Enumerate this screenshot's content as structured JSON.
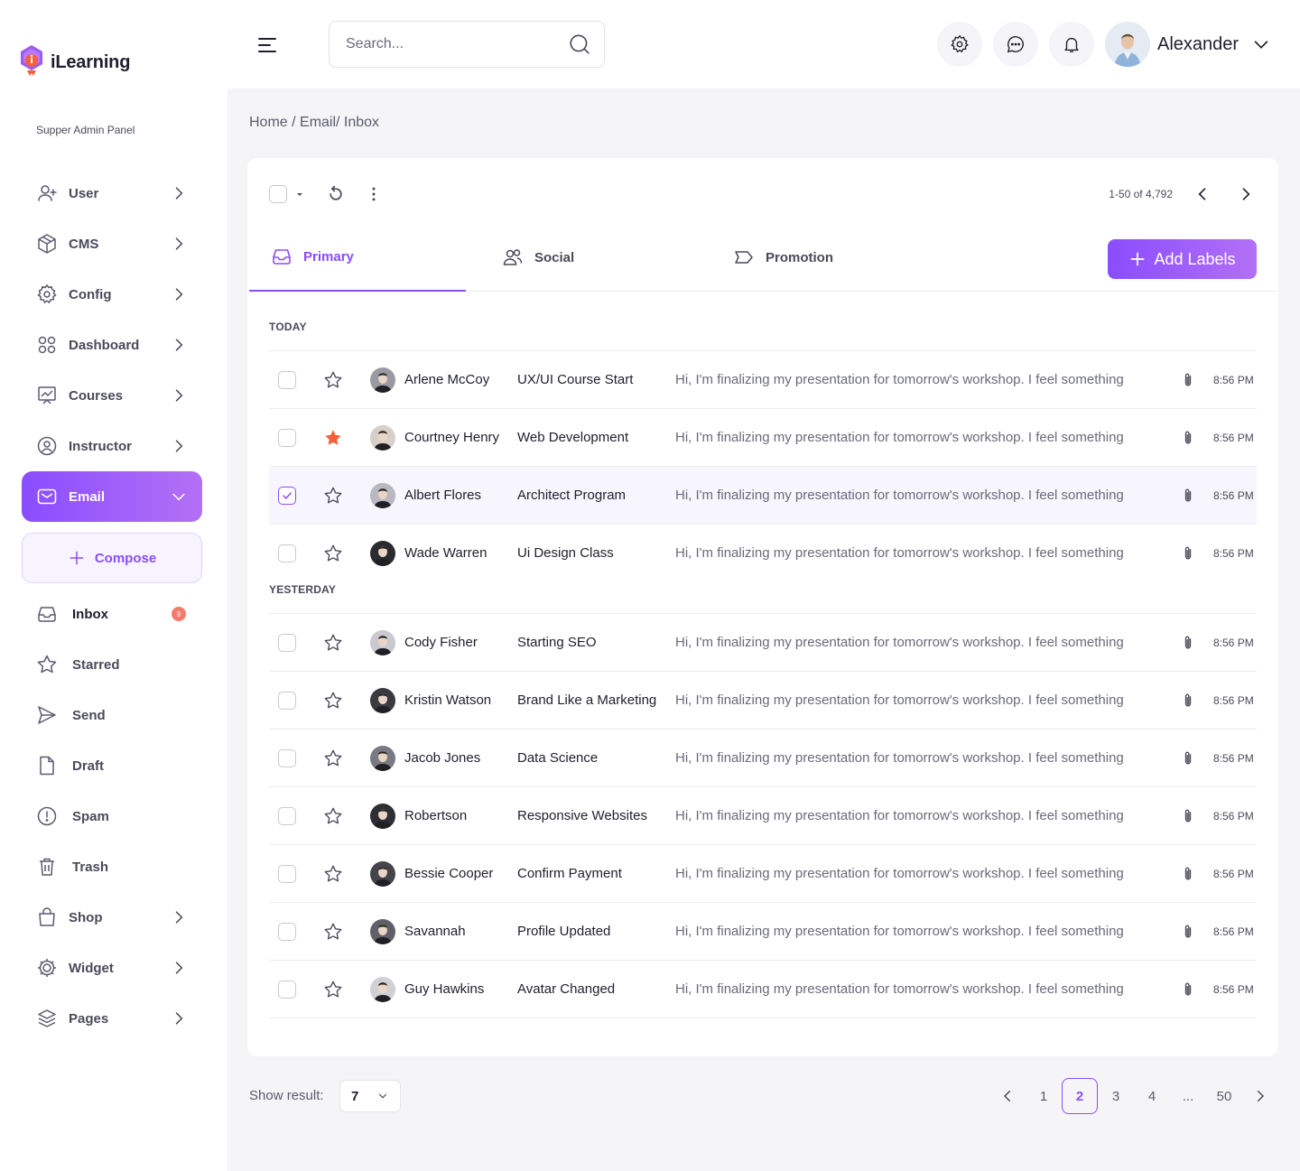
{
  "app": {
    "name": "iLearning",
    "panel_label": "Supper Admin Panel"
  },
  "header": {
    "search_placeholder": "Search...",
    "user_name": "Alexander"
  },
  "sidebar": {
    "items": [
      {
        "label": "User",
        "icon": "user-plus-icon"
      },
      {
        "label": "CMS",
        "icon": "box-icon"
      },
      {
        "label": "Config",
        "icon": "gear-icon"
      },
      {
        "label": "Dashboard",
        "icon": "grid-icon"
      },
      {
        "label": "Courses",
        "icon": "chart-board-icon"
      },
      {
        "label": "Instructor",
        "icon": "user-circle-icon"
      },
      {
        "label": "Email",
        "icon": "mail-icon",
        "active": true
      }
    ],
    "compose_label": "Compose",
    "email_sub": [
      {
        "label": "Inbox",
        "icon": "inbox-icon",
        "badge": "9"
      },
      {
        "label": "Starred",
        "icon": "star-icon"
      },
      {
        "label": "Send",
        "icon": "send-icon"
      },
      {
        "label": "Draft",
        "icon": "file-icon"
      },
      {
        "label": "Spam",
        "icon": "alert-icon"
      },
      {
        "label": "Trash",
        "icon": "trash-icon"
      }
    ],
    "bottom_items": [
      {
        "label": "Shop",
        "icon": "bag-icon"
      },
      {
        "label": "Widget",
        "icon": "cog-icon"
      },
      {
        "label": "Pages",
        "icon": "layers-icon"
      }
    ]
  },
  "breadcrumb": "Home / Email/ Inbox",
  "inbox": {
    "page_info": "1-50 of 4,792",
    "tabs": [
      {
        "label": "Primary",
        "icon": "inbox-icon",
        "active": true
      },
      {
        "label": "Social",
        "icon": "users-icon"
      },
      {
        "label": "Promotion",
        "icon": "tag-icon"
      }
    ],
    "add_labels": "Add Labels",
    "sections": [
      {
        "label": "TODAY",
        "rows": [
          {
            "name": "Arlene McCoy",
            "subject": "UX/UI Course Start",
            "preview": "Hi, I'm finalizing my presentation for tomorrow's workshop. I feel something",
            "time": "8:56 PM",
            "starred": false,
            "checked": false
          },
          {
            "name": "Courtney Henry",
            "subject": "Web Development",
            "preview": "Hi, I'm finalizing my presentation for tomorrow's workshop. I feel something",
            "time": "8:56 PM",
            "starred": true,
            "checked": false
          },
          {
            "name": "Albert Flores",
            "subject": "Architect Program",
            "preview": "Hi, I'm finalizing my presentation for tomorrow's workshop. I feel something",
            "time": "8:56 PM",
            "starred": false,
            "checked": true
          },
          {
            "name": "Wade Warren",
            "subject": "Ui Design Class",
            "preview": "Hi, I'm finalizing my presentation for tomorrow's workshop. I feel something",
            "time": "8:56 PM",
            "starred": false,
            "checked": false
          }
        ]
      },
      {
        "label": "YESTERDAY",
        "rows": [
          {
            "name": "Cody Fisher",
            "subject": "Starting SEO",
            "preview": "Hi, I'm finalizing my presentation for tomorrow's workshop. I feel something",
            "time": "8:56 PM",
            "starred": false,
            "checked": false
          },
          {
            "name": "Kristin Watson",
            "subject": "Brand Like a Marketing",
            "preview": "Hi, I'm finalizing my presentation for tomorrow's workshop. I feel something",
            "time": "8:56 PM",
            "starred": false,
            "checked": false
          },
          {
            "name": "Jacob Jones",
            "subject": "Data Science",
            "preview": "Hi, I'm finalizing my presentation for tomorrow's workshop. I feel something",
            "time": "8:56 PM",
            "starred": false,
            "checked": false
          },
          {
            "name": "Robertson",
            "subject": "Responsive Websites",
            "preview": "Hi, I'm finalizing my presentation for tomorrow's workshop. I feel something",
            "time": "8:56 PM",
            "starred": false,
            "checked": false
          },
          {
            "name": "Bessie Cooper",
            "subject": "Confirm Payment",
            "preview": "Hi, I'm finalizing my presentation for tomorrow's workshop. I feel something",
            "time": "8:56 PM",
            "starred": false,
            "checked": false
          },
          {
            "name": "Savannah",
            "subject": "Profile Updated",
            "preview": "Hi, I'm finalizing my presentation for tomorrow's workshop. I feel something",
            "time": "8:56 PM",
            "starred": false,
            "checked": false
          },
          {
            "name": "Guy Hawkins",
            "subject": "Avatar Changed",
            "preview": "Hi, I'm finalizing my presentation for tomorrow's workshop. I feel something",
            "time": "8:56 PM",
            "starred": false,
            "checked": false
          }
        ]
      }
    ]
  },
  "footer": {
    "show_result_label": "Show result:",
    "show_result_value": "7",
    "pages": [
      "1",
      "2",
      "3",
      "4",
      "...",
      "50"
    ],
    "current_page": "2"
  },
  "colors": {
    "accent": "#8a4dff",
    "accent_light": "#b370f5",
    "star_active": "#f5603a",
    "badge": "#f57a6a"
  }
}
